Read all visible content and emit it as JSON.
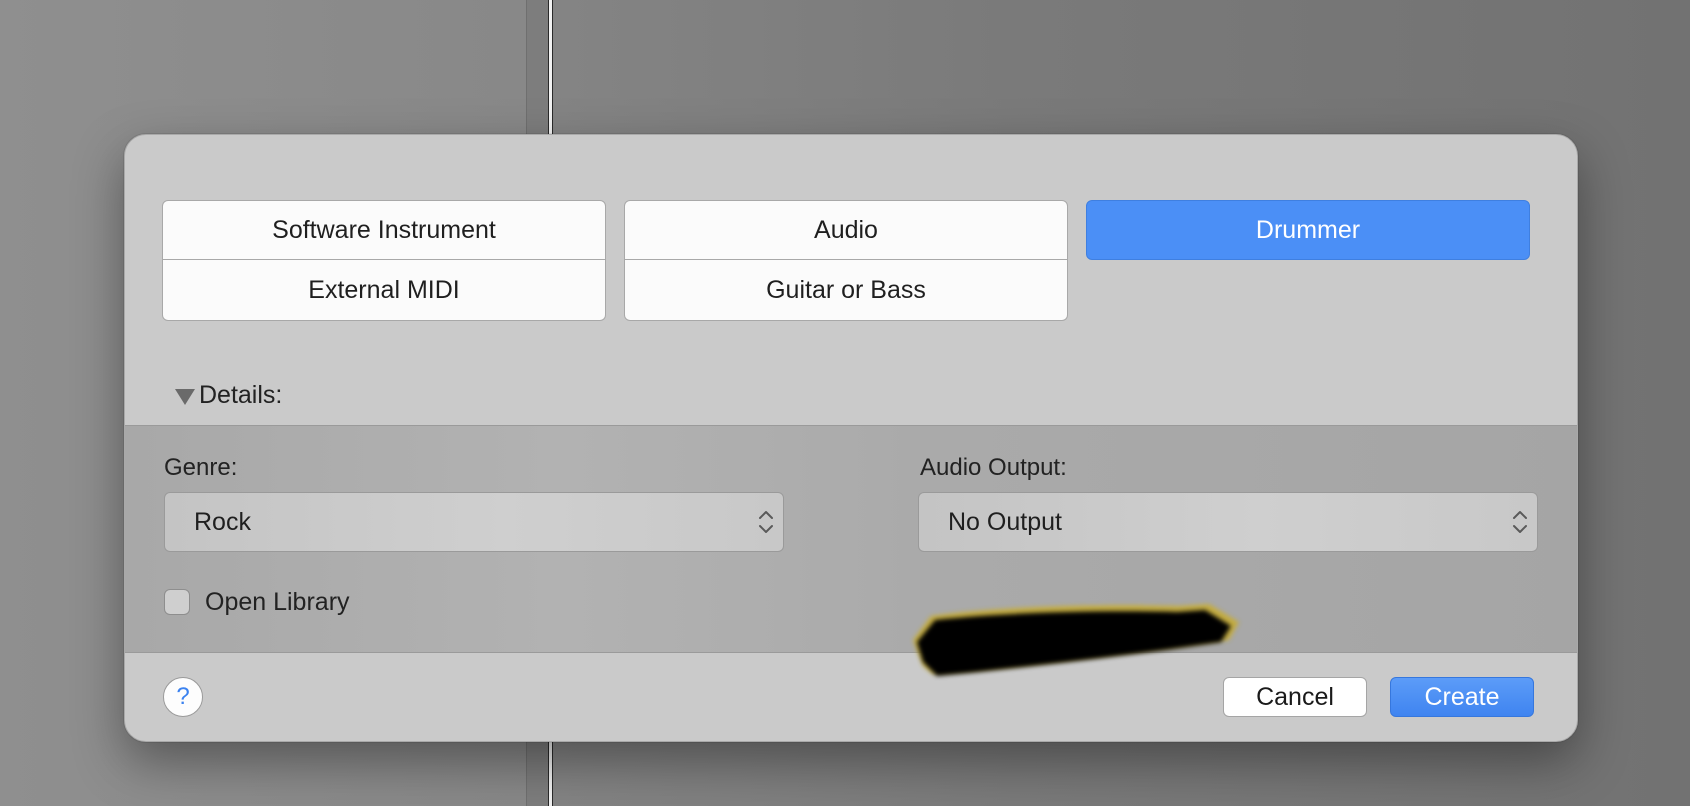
{
  "track_types": {
    "software_instrument": "Software Instrument",
    "audio": "Audio",
    "drummer": "Drummer",
    "external_midi": "External MIDI",
    "guitar_or_bass": "Guitar or Bass",
    "selected": "Drummer"
  },
  "details": {
    "toggle_label": "Details:",
    "expanded": true,
    "genre": {
      "label": "Genre:",
      "value": "Rock"
    },
    "audio_output": {
      "label": "Audio Output:",
      "value": "No Output"
    },
    "open_library": {
      "label": "Open Library",
      "checked": false
    }
  },
  "footer": {
    "help_label": "?",
    "cancel_label": "Cancel",
    "create_label": "Create"
  },
  "colors": {
    "accent": "#4b8ff6",
    "dialog_bg": "#cacaca",
    "details_bg": "#aaaaaa"
  }
}
